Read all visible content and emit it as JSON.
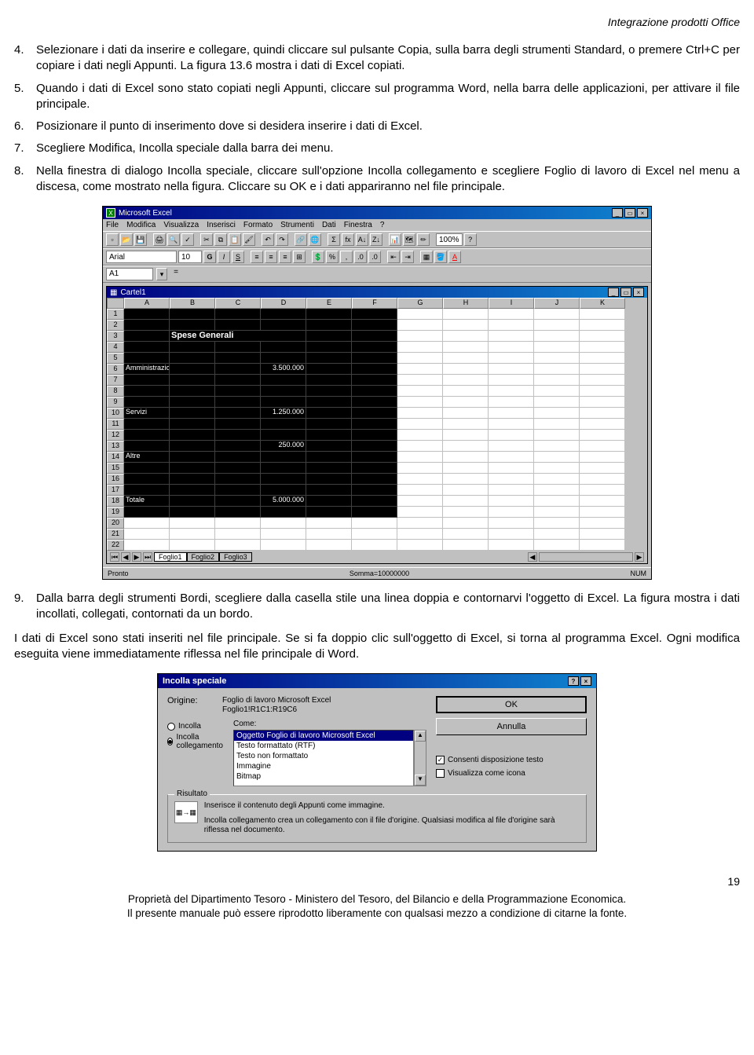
{
  "header": {
    "title": "Integrazione prodotti Office"
  },
  "list1": {
    "i4": "Selezionare i dati da inserire e collegare, quindi cliccare sul pulsante Copia, sulla barra degli strumenti Standard, o premere Ctrl+C per copiare i dati negli Appunti. La figura 13.6 mostra i dati di Excel copiati.",
    "i5": "Quando i dati di Excel sono stato copiati negli Appunti, cliccare sul programma Word, nella barra delle applicazioni, per attivare il file principale.",
    "i6": "Posizionare il punto di inserimento dove si desidera inserire i dati di Excel.",
    "i7": "Scegliere Modifica, Incolla speciale dalla barra dei menu.",
    "i8": "Nella finestra di dialogo Incolla speciale, cliccare sull'opzione Incolla collegamento e scegliere Foglio di lavoro di Excel nel menu a discesa, come mostrato nella figura. Cliccare su OK e i dati appariranno nel file principale."
  },
  "list2": {
    "i9": "Dalla barra degli strumenti Bordi, scegliere dalla casella stile una linea doppia e contornarvi l'oggetto di Excel. La figura mostra i dati incollati, collegati, contornati da un bordo."
  },
  "para1": "I dati di Excel sono stati inseriti nel file principale. Se si fa doppio clic sull'oggetto di Excel, si torna al programma Excel. Ogni modifica eseguita viene immediatamente riflessa nel file principale di Word.",
  "excel": {
    "app_title": "Microsoft Excel",
    "menus": [
      "File",
      "Modifica",
      "Visualizza",
      "Inserisci",
      "Formato",
      "Strumenti",
      "Dati",
      "Finestra",
      "?"
    ],
    "font_name": "Arial",
    "font_size": "10",
    "zoom": "100%",
    "cell_ref": "A1",
    "workbook": "Cartel1",
    "cols": [
      "A",
      "B",
      "C",
      "D",
      "E",
      "F",
      "G",
      "H",
      "I",
      "J",
      "K"
    ],
    "rows": 22,
    "black_cols": 6,
    "data_rows": {
      "3": {
        "col": 1,
        "text": "Spese Generali",
        "bold": true,
        "span": 3
      },
      "6": {
        "col": 0,
        "text": "Amministrazione",
        "val_col": 3,
        "val": "3.500.000"
      },
      "10": {
        "col": 0,
        "text": "Servizi",
        "val_col": 3,
        "val": "1.250.000"
      },
      "13": {
        "col": 0,
        "text": "",
        "val_col": 3,
        "val": "250.000"
      },
      "14": {
        "col": 0,
        "text": "Altre"
      },
      "18": {
        "col": 0,
        "text": "Totale",
        "val_col": 3,
        "val": "5.000.000"
      }
    },
    "dark_last_row": 19,
    "sheet_tabs": [
      "Foglio1",
      "Foglio2",
      "Foglio3"
    ],
    "status_left": "Pronto",
    "status_sum": "Somma=10000000",
    "status_right": "NUM"
  },
  "dialog": {
    "title": "Incolla speciale",
    "origin_label": "Origine:",
    "origin_line1": "Foglio di lavoro Microsoft Excel",
    "origin_line2": "Foglio1!R1C1:R19C6",
    "radio_paste": "Incolla",
    "radio_link": "Incolla collegamento",
    "come_label": "Come:",
    "list": [
      "Oggetto Foglio di lavoro Microsoft Excel",
      "Testo formattato (RTF)",
      "Testo non formattato",
      "Immagine",
      "Bitmap"
    ],
    "ok": "OK",
    "cancel": "Annulla",
    "chk_float": "Consenti disposizione testo",
    "chk_icon": "Visualizza come icona",
    "result_legend": "Risultato",
    "result_l1": "Inserisce il contenuto degli Appunti come immagine.",
    "result_l2": "Incolla collegamento crea un collegamento con il file d'origine. Qualsiasi modifica al file d'origine sarà riflessa nel documento."
  },
  "page_number": "19",
  "footer": {
    "l1": "Proprietà  del Dipartimento Tesoro - Ministero del Tesoro, del Bilancio e della Programmazione Economica.",
    "l2": "Il presente manuale può essere riprodotto liberamente con qualsasi mezzo a condizione di citarne la fonte."
  }
}
